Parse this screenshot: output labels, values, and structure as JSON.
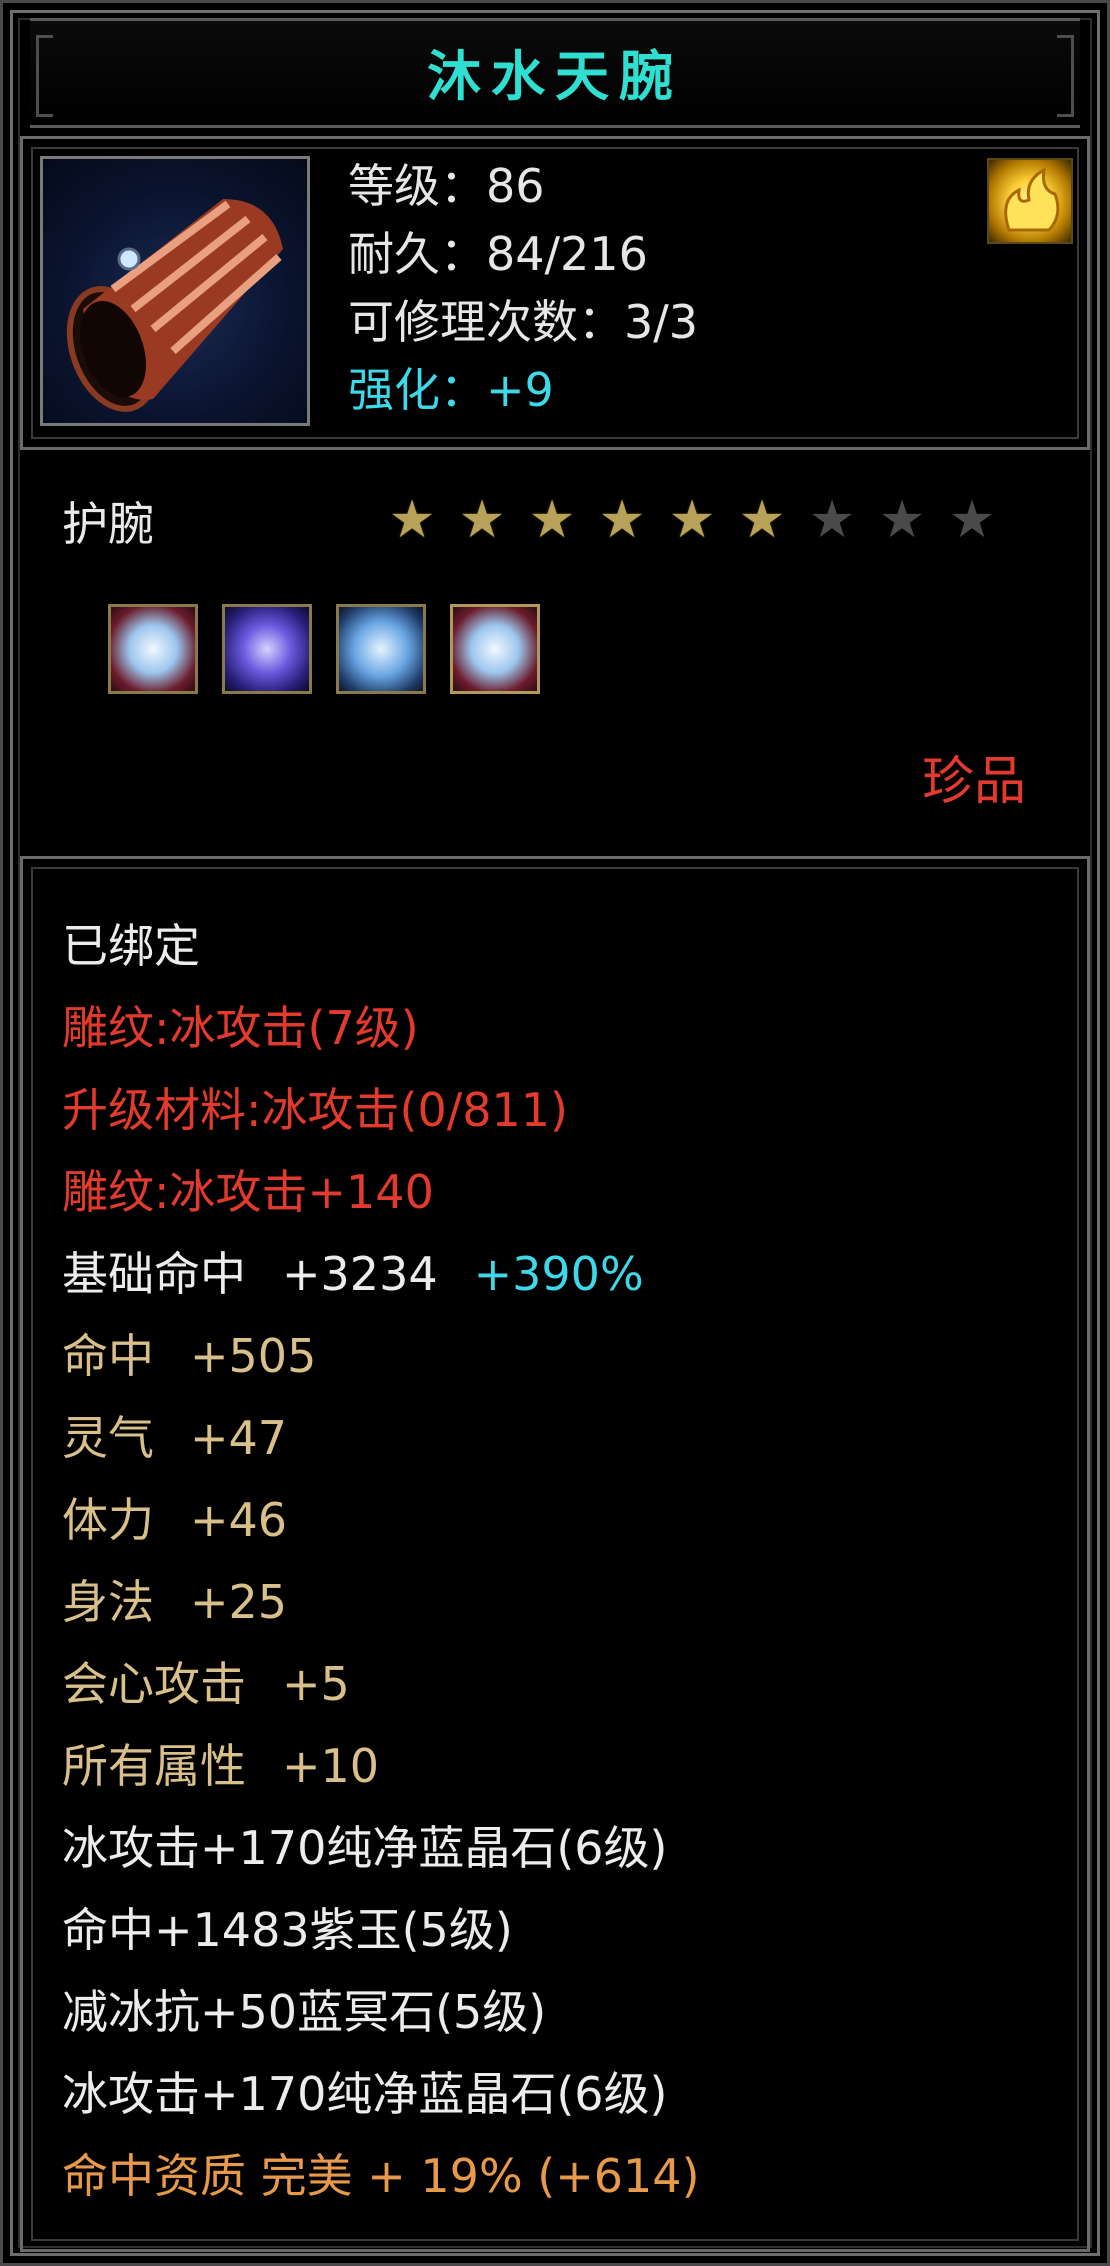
{
  "title": "沐水天腕",
  "item": {
    "icon": "bracer-icon",
    "level_line": "等级：86",
    "durability_line": "耐久：84/216",
    "repair_line": "可修理次数：3/3",
    "enhance_line": "强化：+9"
  },
  "category": "护腕",
  "stars": {
    "lit": 6,
    "total": 9
  },
  "gems": [
    "ice-gem-icon",
    "purple-jade-icon",
    "blue-gem-icon",
    "ice-gem-icon"
  ],
  "rarity": "珍品",
  "attributes": {
    "bound": "已绑定",
    "engrave": "雕纹:冰攻击(7级)",
    "upgrade_material": "升级材料:冰攻击(0/811)",
    "engrave_bonus": "雕纹:冰攻击+140",
    "base_hit_label": "基础命中",
    "base_hit_value": "+3234",
    "base_hit_pct": "+390%",
    "hit_label": "命中",
    "hit_value": "+505",
    "spirit_label": "灵气",
    "spirit_value": "+47",
    "stamina_label": "体力",
    "stamina_value": "+46",
    "agility_label": "身法",
    "agility_value": "+25",
    "crit_label": "会心攻击",
    "crit_value": "+5",
    "allattr_label": "所有属性",
    "allattr_value": "+10",
    "gem1": "冰攻击+170纯净蓝晶石(6级)",
    "gem2": "命中+1483紫玉(5级)",
    "gem3": "减冰抗+50蓝冥石(5级)",
    "gem4": "冰攻击+170纯净蓝晶石(6级)",
    "quality": "命中资质 完美 + 19% (+614)"
  },
  "colors": {
    "title": "#2fe0d2",
    "enhance": "#3ed8e8",
    "red": "#e23a2c",
    "gold": "#d9c08a",
    "orange": "#e89a4a"
  }
}
